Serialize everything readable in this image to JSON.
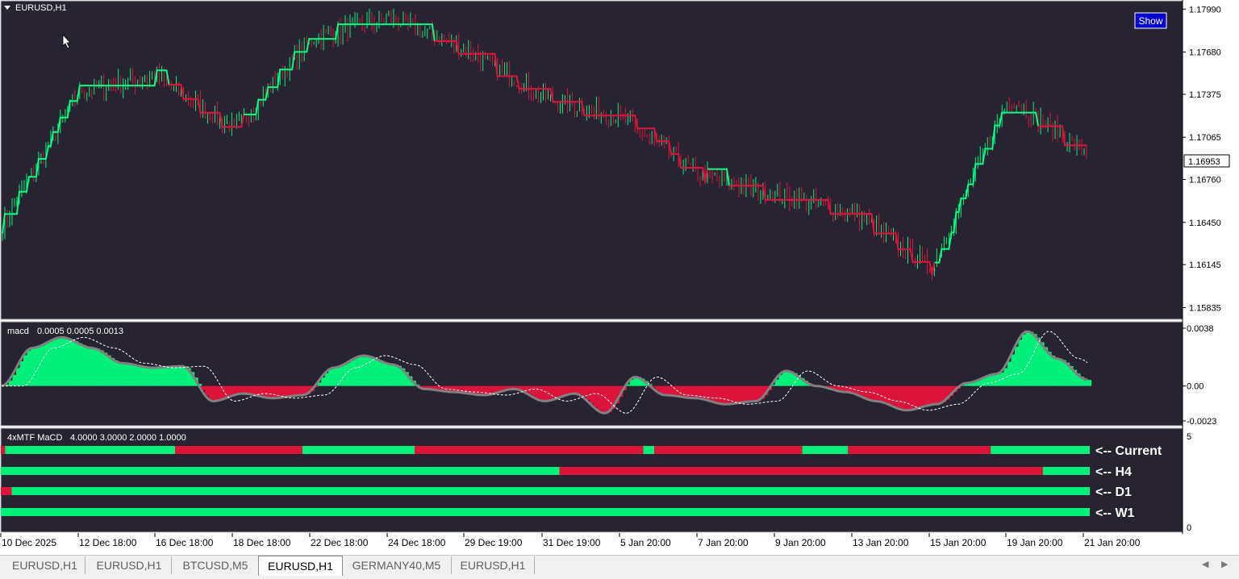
{
  "main_chart": {
    "title": "EURUSD,H1",
    "show_button": "Show",
    "current_price": "1.16953",
    "price_levels": [
      "1.17990",
      "1.17680",
      "1.17375",
      "1.17065",
      "1.16760",
      "1.16450",
      "1.16145",
      "1.15835"
    ]
  },
  "macd_panel": {
    "label": "macd",
    "values": "0.0005 0.0005 0.0013",
    "levels": [
      "0.0038",
      "0.00",
      "-0.0023"
    ]
  },
  "mtf_panel": {
    "label": "4xMTF MaCD",
    "values": "4.0000 3.0000 2.0000 1.0000",
    "scale_top": "5",
    "scale_bottom": "0",
    "rows": [
      {
        "label": "<-- Current",
        "segments": [
          [
            "r",
            0,
            0.004
          ],
          [
            "g",
            0.004,
            0.16
          ],
          [
            "r",
            0.16,
            0.277
          ],
          [
            "g",
            0.277,
            0.38
          ],
          [
            "r",
            0.38,
            0.59
          ],
          [
            "g",
            0.59,
            0.6
          ],
          [
            "r",
            0.6,
            0.736
          ],
          [
            "g",
            0.736,
            0.778
          ],
          [
            "r",
            0.778,
            0.909
          ],
          [
            "g",
            0.909,
            1.0
          ]
        ]
      },
      {
        "label": "<-- H4",
        "segments": [
          [
            "g",
            0,
            0.513
          ],
          [
            "r",
            0.513,
            0.957
          ],
          [
            "g",
            0.957,
            1.0
          ]
        ]
      },
      {
        "label": "<-- D1",
        "segments": [
          [
            "r",
            0,
            0.01
          ],
          [
            "g",
            0.01,
            1.0
          ]
        ]
      },
      {
        "label": "<-- W1",
        "segments": [
          [
            "g",
            0,
            1.0
          ]
        ]
      }
    ]
  },
  "time_axis": [
    "10 Dec 2025",
    "12 Dec 18:00",
    "16 Dec 18:00",
    "18 Dec 18:00",
    "22 Dec 18:00",
    "24 Dec 18:00",
    "29 Dec 19:00",
    "31 Dec 19:00",
    "5 Jan 20:00",
    "7 Jan 20:00",
    "9 Jan 20:00",
    "13 Jan 20:00",
    "15 Jan 20:00",
    "19 Jan 20:00",
    "21 Jan 20:00"
  ],
  "tabs": [
    {
      "label": "EURUSD,H1",
      "active": false
    },
    {
      "label": "EURUSD,H1",
      "active": false
    },
    {
      "label": "BTCUSD,M5",
      "active": false
    },
    {
      "label": "EURUSD,H1",
      "active": true
    },
    {
      "label": "GERMANY40,M5",
      "active": false
    },
    {
      "label": "EURUSD,H1",
      "active": false
    }
  ],
  "colors": {
    "background": "#272330",
    "bull": "#00f07a",
    "bear": "#dc143c",
    "signal_line_up": "#00ff80",
    "signal_line_down": "#dc143c",
    "show_button_bg": "#0000cc"
  },
  "chart_data": {
    "type": "line",
    "title": "EURUSD,H1",
    "ylim": [
      1.1575,
      1.1805
    ],
    "x": [
      "10 Dec 2025",
      "12 Dec 18:00",
      "16 Dec 18:00",
      "18 Dec 18:00",
      "22 Dec 18:00",
      "24 Dec 18:00",
      "29 Dec 19:00",
      "31 Dec 19:00",
      "5 Jan 20:00",
      "7 Jan 20:00",
      "9 Jan 20:00",
      "13 Jan 20:00",
      "15 Jan 20:00",
      "19 Jan 20:00",
      "21 Jan 20:00"
    ],
    "series": [
      {
        "name": "EURUSD,H1",
        "values": [
          1.1643,
          1.174,
          1.175,
          1.1712,
          1.1778,
          1.1793,
          1.177,
          1.1735,
          1.172,
          1.168,
          1.1665,
          1.1652,
          1.1612,
          1.1735,
          1.1695
        ]
      }
    ],
    "macd": {
      "ylim": [
        -0.0023,
        0.0038
      ],
      "values": [
        0.0,
        0.0025,
        0.0032,
        0.0025,
        0.0015,
        0.0012,
        0.0013,
        -0.001,
        -0.0005,
        -0.0008,
        -0.0006,
        0.0012,
        0.002,
        0.0014,
        -0.0002,
        -0.0004,
        -0.0006,
        -0.0002,
        -0.001,
        -0.0005,
        -0.0018,
        0.0006,
        -0.0006,
        -0.0008,
        -0.0012,
        -0.001,
        0.001,
        0.0,
        -0.0004,
        -0.001,
        -0.0016,
        -0.0012,
        0.0002,
        0.0008,
        0.0036,
        0.0018,
        0.0004
      ]
    }
  }
}
